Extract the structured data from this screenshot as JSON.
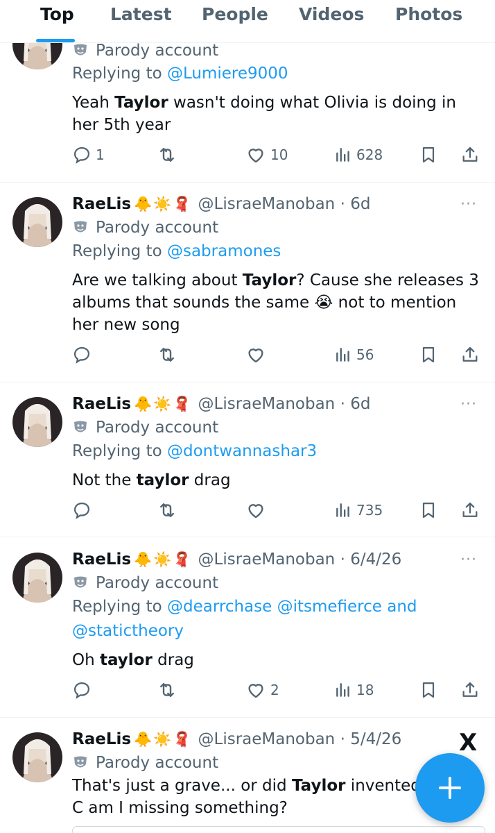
{
  "tabs": [
    "Top",
    "Latest",
    "People",
    "Videos",
    "Photos"
  ],
  "parody_label": "Parody account",
  "replying_prefix": "Replying to",
  "tweets": [
    {
      "name": "",
      "handle": "",
      "replying_to": [
        {
          "text": "@Lumiere9000"
        }
      ],
      "text": [
        {
          "t": "Yeah "
        },
        {
          "t": "Taylor",
          "b": true
        },
        {
          "t": " wasn't doing what Olivia is doing in her 5th year"
        }
      ],
      "counts": {
        "reply": "1",
        "retweet": "",
        "like": "10",
        "views": "628"
      }
    },
    {
      "name": "RaeLis",
      "emojis": "🐥☀️🧣",
      "handle": "@LisraeManoban · 6d",
      "replying_to": [
        {
          "text": "@sabramones"
        }
      ],
      "text": [
        {
          "t": "Are we talking about "
        },
        {
          "t": "Taylor",
          "b": true
        },
        {
          "t": "? Cause she releases 3 albums that sounds the same 😭 not to mention her new song"
        }
      ],
      "counts": {
        "reply": "",
        "retweet": "",
        "like": "",
        "views": "56"
      }
    },
    {
      "name": "RaeLis",
      "emojis": "🐥☀️🧣",
      "handle": "@LisraeManoban · 6d",
      "replying_to": [
        {
          "text": "@dontwannashar3"
        }
      ],
      "text": [
        {
          "t": "Not the "
        },
        {
          "t": "taylor",
          "b": true
        },
        {
          "t": " drag"
        }
      ],
      "counts": {
        "reply": "",
        "retweet": "",
        "like": "",
        "views": "735"
      }
    },
    {
      "name": "RaeLis",
      "emojis": "🐥☀️🧣",
      "handle": "@LisraeManoban · 6/4/26",
      "replying_to": [
        {
          "text": "@dearrchase"
        },
        {
          "text": " @itsmefierce"
        },
        {
          "text": " and"
        },
        {
          "text": " @statictheory"
        }
      ],
      "text": [
        {
          "t": "Oh "
        },
        {
          "t": "taylor",
          "b": true
        },
        {
          "t": " drag"
        }
      ],
      "counts": {
        "reply": "",
        "retweet": "",
        "like": "2",
        "views": "18"
      }
    },
    {
      "name": "RaeLis",
      "emojis": "🐥☀️🧣",
      "handle": "@LisraeManoban · 5/4/26",
      "replying_to": [],
      "text": [
        {
          "t": "That's just a grave... or did "
        },
        {
          "t": "Taylor",
          "b": true
        },
        {
          "t": " invented C am I missing something?"
        }
      ],
      "counts": {}
    }
  ],
  "more_label": "···",
  "x_logo": "X",
  "colors": {
    "accent": "#1d9bf0",
    "secondary_text": "#536471",
    "text": "#0f1419",
    "divider": "#eff3f4"
  },
  "icons": [
    "reply-icon",
    "retweet-icon",
    "like-icon",
    "views-icon",
    "bookmark-icon",
    "share-icon",
    "parody-mask-icon",
    "compose-plus-icon",
    "more-dots-icon"
  ]
}
